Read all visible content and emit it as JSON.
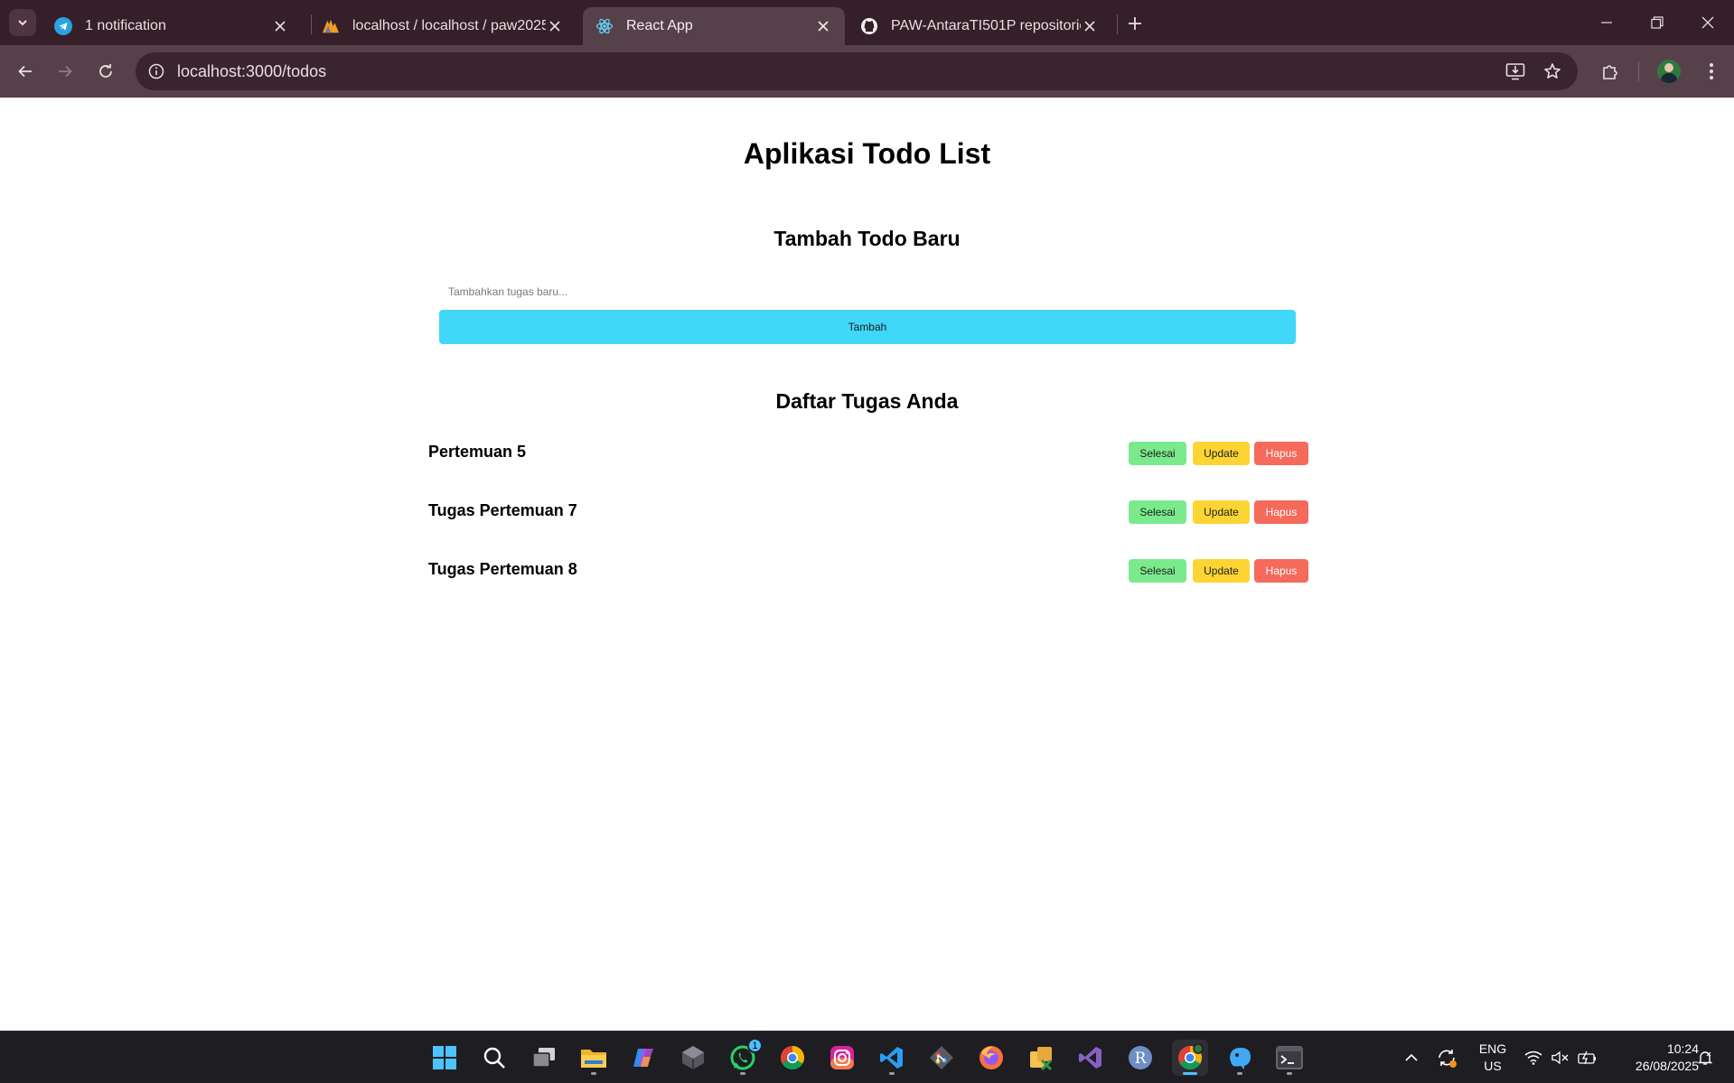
{
  "browser": {
    "tabs": [
      {
        "title": "1 notification",
        "icon": "telegram-icon",
        "active": false
      },
      {
        "title": "localhost / localhost / paw2025",
        "icon": "phpmyadmin-icon",
        "active": false
      },
      {
        "title": "React App",
        "icon": "react-icon",
        "active": true
      },
      {
        "title": "PAW-AntaraTI501P repositories",
        "icon": "github-icon",
        "active": false
      }
    ],
    "address_bar": {
      "url": "localhost:3000/todos"
    }
  },
  "app": {
    "title": "Aplikasi Todo List",
    "add_section": {
      "title": "Tambah Todo Baru",
      "input_placeholder": "Tambahkan tugas baru...",
      "input_value": "",
      "add_button_label": "Tambah"
    },
    "list_section": {
      "title": "Daftar Tugas Anda",
      "todos": [
        {
          "text": "Pertemuan 5",
          "done_label": "Selesai",
          "update_label": "Update",
          "delete_label": "Hapus"
        },
        {
          "text": "Tugas Pertemuan 7",
          "done_label": "Selesai",
          "update_label": "Update",
          "delete_label": "Hapus"
        },
        {
          "text": "Tugas Pertemuan 8",
          "done_label": "Selesai",
          "update_label": "Update",
          "delete_label": "Hapus"
        }
      ]
    },
    "colors": {
      "add_button": "#40d7f8",
      "done_button": "#7aea8d",
      "update_button": "#fcd535",
      "delete_button": "#f56a5a"
    }
  },
  "taskbar": {
    "apps": [
      "windows-start-icon",
      "search-icon",
      "task-view-icon",
      "file-explorer-icon",
      "copilot-icon",
      "cube-app-icon",
      "whatsapp-icon",
      "chrome-icon",
      "instagram-icon",
      "vscode-icon",
      "git-icon",
      "firefox-icon",
      "app-icon",
      "visual-studio-icon",
      "r-icon",
      "chrome-profile-icon",
      "mysql-workbench-icon",
      "terminal-icon"
    ],
    "whatsapp_badge": "1",
    "language": {
      "line1": "ENG",
      "line2": "US"
    },
    "time": "10:24",
    "date": "26/08/2025"
  }
}
